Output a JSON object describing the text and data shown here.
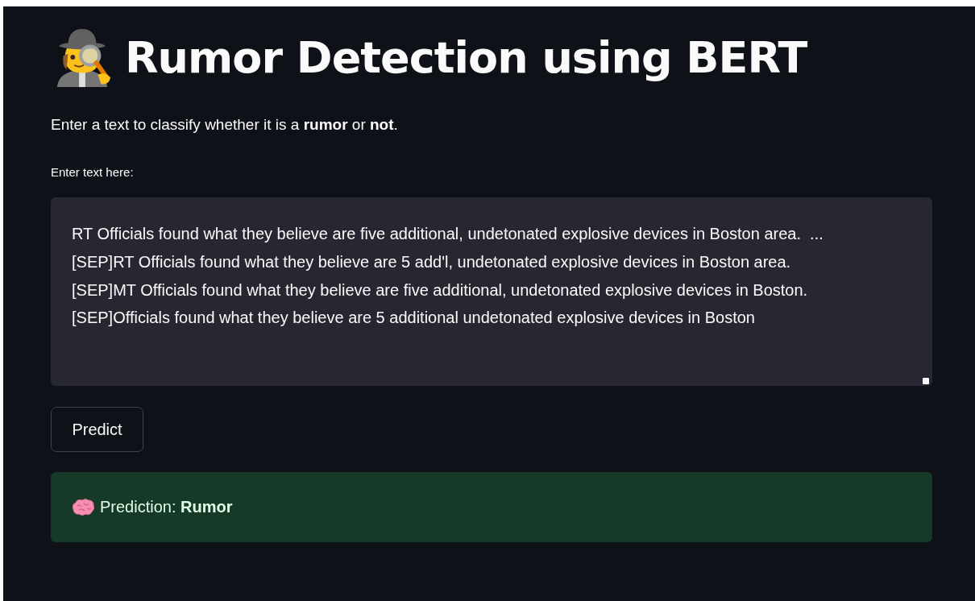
{
  "title": "Rumor Detection using BERT",
  "description": "Enter a text to classify whether it is a **rumor** or **not**.",
  "input": {
    "label": "Enter text here:",
    "value": "RT Officials found what they believe are five additional, undetonated explosive devices in Boston area.  ...\n[SEP]RT Officials found what they believe are 5 add'l, undetonated explosive devices in Boston area.\n[SEP]MT Officials found what they believe are five additional, undetonated explosive devices in Boston.\n[SEP]Officials found what they believe are 5 additional undetonated explosive devices in Boston"
  },
  "button": "Predict",
  "result": {
    "kind": "success",
    "text": "Prediction: **Rumor**"
  }
}
